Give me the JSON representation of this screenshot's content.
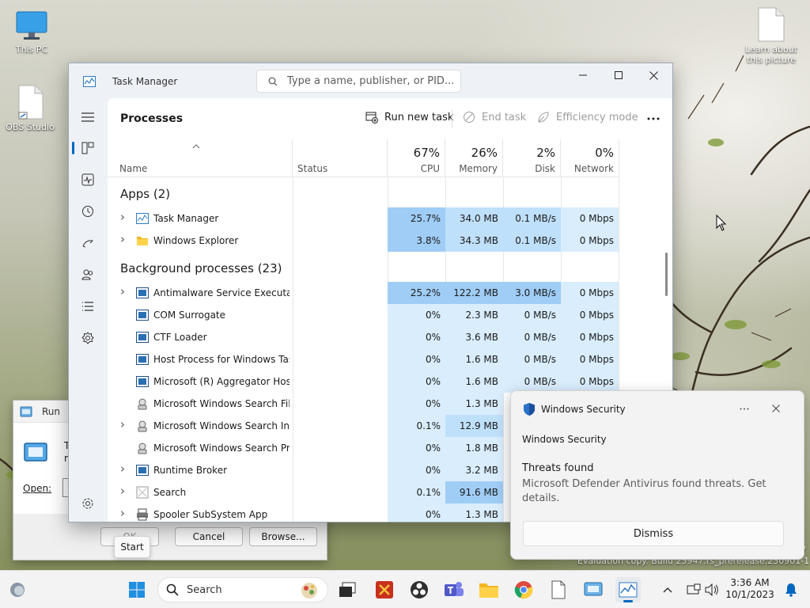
{
  "desktop": {
    "icons": [
      {
        "label": "This PC"
      },
      {
        "label": "OBS Studio"
      },
      {
        "label": "Learn about this picture"
      }
    ],
    "watermark_lines": [
      "ew",
      "Evaluation copy. Build 25947.rs_prerelease.230901-1416"
    ]
  },
  "run_dialog": {
    "title": "Run",
    "desc_fragment_1": "Ty",
    "desc_fragment_2": "re",
    "open_label": "Open:",
    "ok_label": "OK",
    "cancel_label": "Cancel",
    "browse_label": "Browse..."
  },
  "task_manager": {
    "title": "Task Manager",
    "search_placeholder": "Type a name, publisher, or PID...",
    "page_title": "Processes",
    "toolbar": {
      "run_new_task": "Run new task",
      "end_task": "End task",
      "efficiency_mode": "Efficiency mode"
    },
    "columns": {
      "name": "Name",
      "status": "Status",
      "cpu": {
        "pct": "67%",
        "label": "CPU"
      },
      "memory": {
        "pct": "26%",
        "label": "Memory"
      },
      "disk": {
        "pct": "2%",
        "label": "Disk"
      },
      "network": {
        "pct": "0%",
        "label": "Network"
      }
    },
    "groups": {
      "apps": "Apps (2)",
      "background": "Background processes (23)"
    },
    "apps": [
      {
        "name": "Task Manager",
        "cpu": "25.7%",
        "memory": "34.0 MB",
        "disk": "0.1 MB/s",
        "network": "0 Mbps",
        "expandable": true
      },
      {
        "name": "Windows Explorer",
        "cpu": "3.8%",
        "memory": "34.3 MB",
        "disk": "0.1 MB/s",
        "network": "0 Mbps",
        "expandable": true
      }
    ],
    "background": [
      {
        "name": "Antimalware Service Executable",
        "cpu": "25.2%",
        "memory": "122.2 MB",
        "disk": "3.0 MB/s",
        "network": "0 Mbps",
        "expandable": true
      },
      {
        "name": "COM Surrogate",
        "cpu": "0%",
        "memory": "2.3 MB",
        "disk": "0 MB/s",
        "network": "0 Mbps",
        "expandable": false
      },
      {
        "name": "CTF Loader",
        "cpu": "0%",
        "memory": "3.6 MB",
        "disk": "0 MB/s",
        "network": "0 Mbps",
        "expandable": false
      },
      {
        "name": "Host Process for Windows Tasks",
        "cpu": "0%",
        "memory": "1.6 MB",
        "disk": "0 MB/s",
        "network": "0 Mbps",
        "expandable": false
      },
      {
        "name": "Microsoft (R) Aggregator Host",
        "cpu": "0%",
        "memory": "1.6 MB",
        "disk": "0 MB/s",
        "network": "0 Mbps",
        "expandable": false
      },
      {
        "name": "Microsoft Windows Search Filt...",
        "cpu": "0%",
        "memory": "1.3 MB",
        "disk": "",
        "network": "",
        "expandable": false
      },
      {
        "name": "Microsoft Windows Search In...",
        "cpu": "0.1%",
        "memory": "12.9 MB",
        "disk": "",
        "network": "",
        "expandable": true
      },
      {
        "name": "Microsoft Windows Search Pr...",
        "cpu": "0%",
        "memory": "1.8 MB",
        "disk": "",
        "network": "",
        "expandable": false
      },
      {
        "name": "Runtime Broker",
        "cpu": "0%",
        "memory": "3.2 MB",
        "disk": "",
        "network": "",
        "expandable": true
      },
      {
        "name": "Search",
        "cpu": "0.1%",
        "memory": "91.6 MB",
        "disk": "",
        "network": "",
        "expandable": true
      },
      {
        "name": "Spooler SubSystem App",
        "cpu": "0%",
        "memory": "1.3 MB",
        "disk": "",
        "network": "",
        "expandable": true
      }
    ]
  },
  "notification": {
    "app": "Windows Security",
    "header": "Windows Security",
    "title": "Threats found",
    "body": "Microsoft Defender Antivirus found threats. Get details.",
    "dismiss": "Dismiss"
  },
  "taskbar": {
    "search_label": "Search",
    "start_tooltip": "Start",
    "time": "3:36 AM",
    "date": "10/1/2023"
  },
  "colors": {
    "heat_high": "#9fcdf6",
    "heat_mid": "#bfe0fb",
    "heat_low": "#d9edfd",
    "accent": "#0067c0"
  }
}
